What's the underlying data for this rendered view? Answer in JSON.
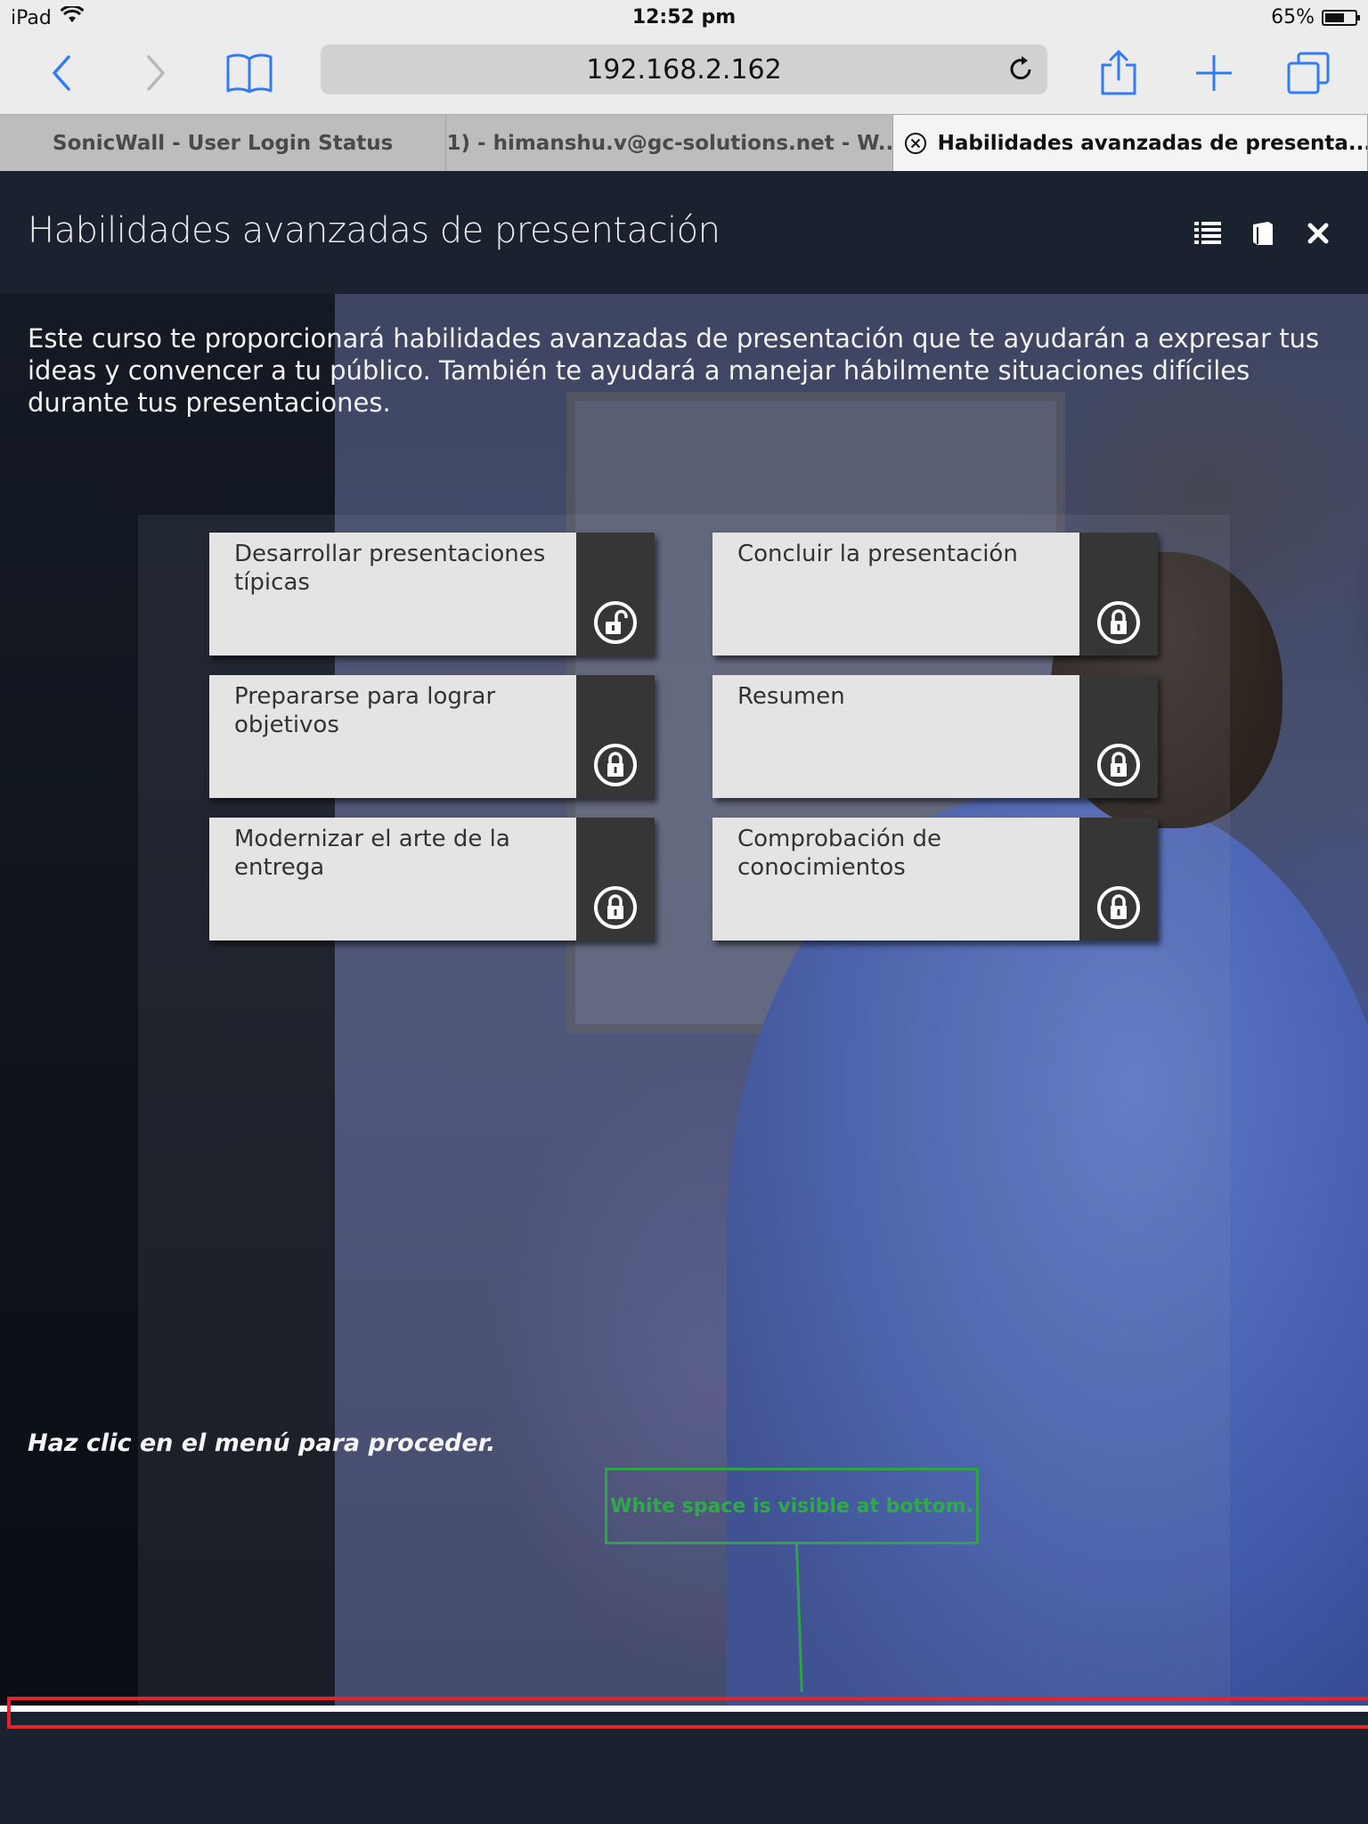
{
  "status_bar": {
    "device": "iPad",
    "time": "12:52 pm",
    "battery_text": "65%",
    "battery_level": 0.65
  },
  "browser": {
    "url": "192.168.2.162",
    "icons": {
      "back": "chevron-left-icon",
      "forward": "chevron-right-icon",
      "bookmarks": "book-icon",
      "reload": "reload-icon",
      "share": "share-icon",
      "new_tab": "plus-icon",
      "tabs": "tabs-icon"
    },
    "tabs": [
      {
        "label": "SonicWall - User Login Status",
        "active": false
      },
      {
        "label": "(1) - himanshu.v@gc-solutions.net - W...",
        "active": false
      },
      {
        "label": "Habilidades avanzadas de presenta...",
        "active": true
      }
    ]
  },
  "course": {
    "title": "Habilidades avanzadas de presentación",
    "header_icons": [
      "list-icon",
      "book-icon",
      "close-icon"
    ],
    "intro": "Este curso te proporcionará habilidades avanzadas de presentación que te ayudarán a expresar tus ideas y convencer a tu público. También te ayudará a manejar hábilmente situaciones difíciles durante tus presentaciones.",
    "menu": [
      {
        "label": "Desarrollar presentaciones típicas",
        "status": "unlocked"
      },
      {
        "label": "Concluir la presentación",
        "status": "locked"
      },
      {
        "label": "Prepararse para lograr objetivos",
        "status": "locked"
      },
      {
        "label": "Resumen",
        "status": "locked"
      },
      {
        "label": "Modernizar el arte de la entrega",
        "status": "locked"
      },
      {
        "label": "Comprobación de conocimientos",
        "status": "locked"
      }
    ],
    "cta": "Haz clic en el menú para proceder."
  },
  "annotation": {
    "text": "White space is visible at bottom.",
    "color": "#2fa24a",
    "highlight_color": "#e3222b"
  }
}
